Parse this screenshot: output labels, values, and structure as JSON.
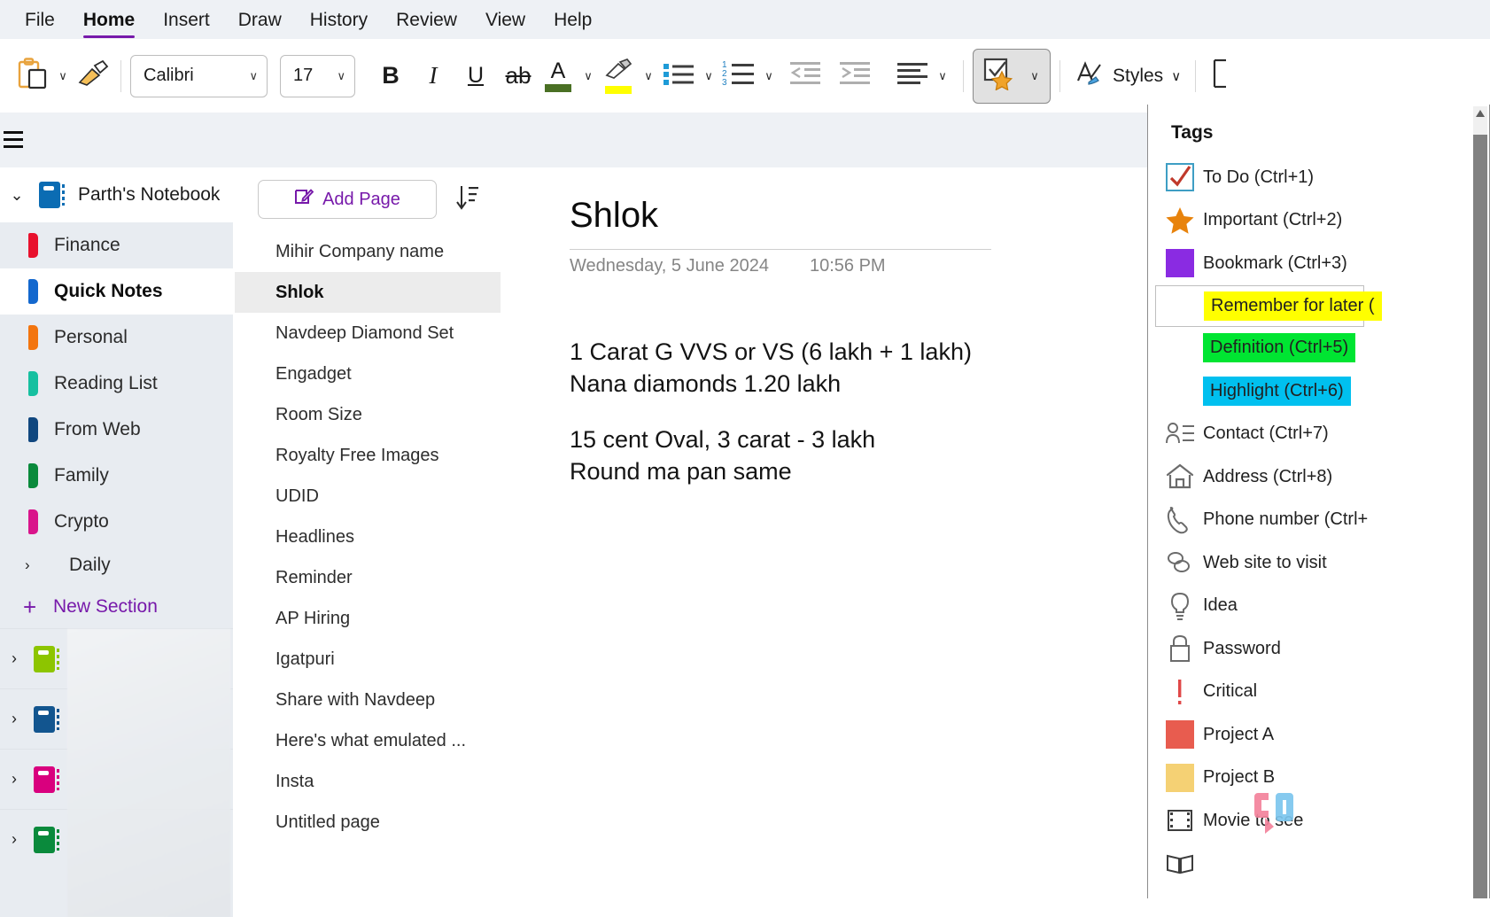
{
  "menu": {
    "items": [
      {
        "label": "File",
        "active": false
      },
      {
        "label": "Home",
        "active": true
      },
      {
        "label": "Insert",
        "active": false
      },
      {
        "label": "Draw",
        "active": false
      },
      {
        "label": "History",
        "active": false
      },
      {
        "label": "Review",
        "active": false
      },
      {
        "label": "View",
        "active": false
      },
      {
        "label": "Help",
        "active": false
      }
    ],
    "accent": "#7719aa"
  },
  "ribbon": {
    "paste_icon": "paste-icon",
    "format_painter_icon": "format-painter-icon",
    "font": {
      "value": "Calibri",
      "caret": "∨"
    },
    "size": {
      "value": "17",
      "caret": "∨"
    },
    "bold": "B",
    "italic": "I",
    "underline": "U",
    "strikethrough": "ab",
    "font_color": "A",
    "font_color_swatch": "#4a7024",
    "highlight_swatch": "#ffff00",
    "bullets_icon": "bulleted-list-icon",
    "numbering_icon": "numbered-list-icon",
    "decrease_indent_icon": "decrease-indent-icon",
    "increase_indent_icon": "increase-indent-icon",
    "align_icon": "align-icon",
    "tags_icon": "tags-icon",
    "styles_label": "Styles",
    "styles_caret": "∨",
    "caret": "∨"
  },
  "sidebar": {
    "notebook": {
      "name": "Parth's Notebook",
      "color": "#0b6cb3",
      "chevron": "⌄"
    },
    "sections": [
      {
        "label": "Finance",
        "color": "#e8112d",
        "selected": false
      },
      {
        "label": "Quick Notes",
        "color": "#1368ce",
        "selected": true
      },
      {
        "label": "Personal",
        "color": "#f3750f",
        "selected": false
      },
      {
        "label": "Reading List",
        "color": "#16c0a0",
        "selected": false
      },
      {
        "label": "From Web",
        "color": "#10477f",
        "selected": false
      },
      {
        "label": "Family",
        "color": "#0a8a3c",
        "selected": false
      },
      {
        "label": "Crypto",
        "color": "#d9158b",
        "selected": false
      }
    ],
    "group": {
      "label": "Daily",
      "chevron": "›"
    },
    "new_section": {
      "label": "New Section",
      "plus": "+"
    },
    "other_notebooks": [
      {
        "color": "#8dc500",
        "label": "",
        "chevron": "›"
      },
      {
        "color": "#12558f",
        "label": "",
        "chevron": "›"
      },
      {
        "color": "#d9007e",
        "label": "",
        "chevron": "›"
      },
      {
        "color": "#0a8a3c",
        "label": "",
        "chevron": "›"
      }
    ]
  },
  "pagelist": {
    "add_page_label": "Add Page",
    "add_page_icon": "compose-icon",
    "sort_icon": "sort-descending-icon",
    "pages": [
      {
        "title": "Mihir Company name",
        "selected": false
      },
      {
        "title": "Shlok",
        "selected": true
      },
      {
        "title": "Navdeep Diamond Set",
        "selected": false
      },
      {
        "title": "Engadget",
        "selected": false
      },
      {
        "title": "Room Size",
        "selected": false
      },
      {
        "title": "Royalty Free Images",
        "selected": false
      },
      {
        "title": "UDID",
        "selected": false
      },
      {
        "title": "Headlines",
        "selected": false
      },
      {
        "title": "Reminder",
        "selected": false
      },
      {
        "title": "AP Hiring",
        "selected": false
      },
      {
        "title": "Igatpuri",
        "selected": false
      },
      {
        "title": "Share with Navdeep",
        "selected": false
      },
      {
        "title": "Here's what emulated ...",
        "selected": false
      },
      {
        "title": "Insta",
        "selected": false
      },
      {
        "title": "Untitled page",
        "selected": false
      }
    ]
  },
  "note": {
    "title": "Shlok",
    "date": "Wednesday, 5 June 2024",
    "time": "10:56 PM",
    "lines": [
      "1 Carat G VVS or VS (6 lakh + 1 lakh)",
      "Nana diamonds 1.20 lakh",
      "",
      "15 cent Oval, 3 carat - 3 lakh",
      "Round ma pan same"
    ],
    "body_line_1": "1 Carat G VVS or VS (6 lakh + 1 lakh)",
    "body_line_2": "Nana diamonds 1.20 lakh",
    "body_line_3": "15 cent Oval, 3 carat - 3 lakh",
    "body_line_4": "Round ma pan same"
  },
  "tags_panel": {
    "title": "Tags",
    "tags": [
      {
        "label": "To Do (Ctrl+1)",
        "icon": "checkbox-checked-icon",
        "style": "icon",
        "color": "#c0392b"
      },
      {
        "label": "Important (Ctrl+2)",
        "icon": "star-icon",
        "style": "icon",
        "color": "#e8830c"
      },
      {
        "label": "Bookmark (Ctrl+3)",
        "icon": "square-swatch-icon",
        "style": "swatch",
        "color": "#8a2be2"
      },
      {
        "label": "Remember for later (",
        "icon": "highlight-icon",
        "style": "highlight-boxed",
        "color": "#ffff00"
      },
      {
        "label": "Definition (Ctrl+5)",
        "icon": "highlight-icon",
        "style": "highlight",
        "color": "#00e532"
      },
      {
        "label": "Highlight (Ctrl+6)",
        "icon": "highlight-icon",
        "style": "highlight",
        "color": "#00c0ef"
      },
      {
        "label": "Contact (Ctrl+7)",
        "icon": "contact-icon",
        "style": "icon",
        "color": "#6b6b6b"
      },
      {
        "label": "Address (Ctrl+8)",
        "icon": "home-icon",
        "style": "icon",
        "color": "#6b6b6b"
      },
      {
        "label": "Phone number (Ctrl+",
        "icon": "phone-icon",
        "style": "icon",
        "color": "#6b6b6b"
      },
      {
        "label": "Web site to visit",
        "icon": "link-icon",
        "style": "icon",
        "color": "#6b6b6b"
      },
      {
        "label": "Idea",
        "icon": "lightbulb-icon",
        "style": "icon",
        "color": "#6b6b6b"
      },
      {
        "label": "Password",
        "icon": "lock-icon",
        "style": "icon",
        "color": "#6b6b6b"
      },
      {
        "label": "Critical",
        "icon": "exclamation-icon",
        "style": "icon",
        "color": "#e04848"
      },
      {
        "label": "Project A",
        "icon": "square-swatch-icon",
        "style": "swatch",
        "color": "#e85c4f"
      },
      {
        "label": "Project B",
        "icon": "square-swatch-icon",
        "style": "swatch",
        "color": "#f5d174"
      },
      {
        "label": "Movie to see",
        "icon": "film-icon",
        "style": "icon",
        "color": "#3d3d3d"
      },
      {
        "label": "",
        "icon": "book-icon",
        "style": "icon",
        "color": "#3d3d3d"
      }
    ],
    "scrollbar": "vertical-scrollbar"
  },
  "watermark": {
    "text": "XDA"
  }
}
